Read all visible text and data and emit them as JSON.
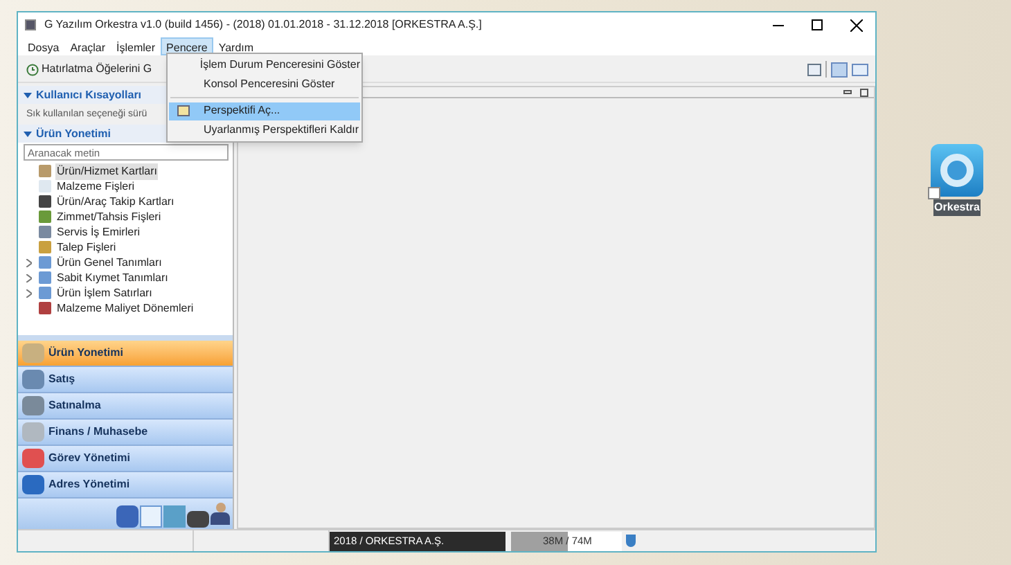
{
  "window": {
    "title": "G Yazılım Orkestra v1.0 (build 1456) - (2018) 01.01.2018 - 31.12.2018 [ORKESTRA A.Ş.]"
  },
  "menu": [
    {
      "label": "Dosya",
      "selected": false
    },
    {
      "label": "Araçlar",
      "selected": false
    },
    {
      "label": "İşlemler",
      "selected": false
    },
    {
      "label": "Pencere",
      "selected": true
    },
    {
      "label": "Yardım",
      "selected": false
    }
  ],
  "dropdown": [
    {
      "label": "İşlem Durum Penceresini Göster",
      "selected": false,
      "icon": false
    },
    {
      "label": "Konsol Penceresini Göster",
      "selected": false,
      "icon": false
    },
    {
      "label": "Perspektifi Aç...",
      "selected": true,
      "icon": true
    },
    {
      "label": "Uyarlanmış Perspektifleri Kaldır",
      "selected": false,
      "icon": false
    }
  ],
  "toolbar": {
    "reminder_button": "Hatırlatma Öğelerini G"
  },
  "shortcuts": {
    "title": "Kullanıcı Kısayolları",
    "hint": "Sık kullanılan seçeneği sürü"
  },
  "module": {
    "title": "Ürün Yonetimi",
    "search_placeholder": "Aranacak metin",
    "tree": [
      {
        "label": "Ürün/Hizmet Kartları",
        "selected": true,
        "expandable": false
      },
      {
        "label": "Malzeme Fişleri",
        "selected": false,
        "expandable": false
      },
      {
        "label": "Ürün/Araç Takip Kartları",
        "selected": false,
        "expandable": false
      },
      {
        "label": "Zimmet/Tahsis Fişleri",
        "selected": false,
        "expandable": false
      },
      {
        "label": "Servis İş Emirleri",
        "selected": false,
        "expandable": false
      },
      {
        "label": "Talep Fişleri",
        "selected": false,
        "expandable": false
      },
      {
        "label": "Ürün Genel Tanımları",
        "selected": false,
        "expandable": true
      },
      {
        "label": "Sabit Kıymet Tanımları",
        "selected": false,
        "expandable": true
      },
      {
        "label": "Ürün İşlem Satırları",
        "selected": false,
        "expandable": true
      },
      {
        "label": "Malzeme Maliyet Dönemleri",
        "selected": false,
        "expandable": false
      }
    ]
  },
  "nav": [
    {
      "label": "Ürün Yonetimi",
      "selected": true
    },
    {
      "label": "Satış",
      "selected": false
    },
    {
      "label": "Satınalma",
      "selected": false
    },
    {
      "label": "Finans / Muhasebe",
      "selected": false
    },
    {
      "label": "Görev Yönetimi",
      "selected": false
    },
    {
      "label": "Adres Yönetimi",
      "selected": false
    }
  ],
  "status_bar": {
    "company": "2018 / ORKESTRA A.Ş.",
    "memory": "38M / 74M",
    "memory_used": {
      "level": 0.51
    }
  },
  "desktop_icon": {
    "label": "Orkestra"
  }
}
